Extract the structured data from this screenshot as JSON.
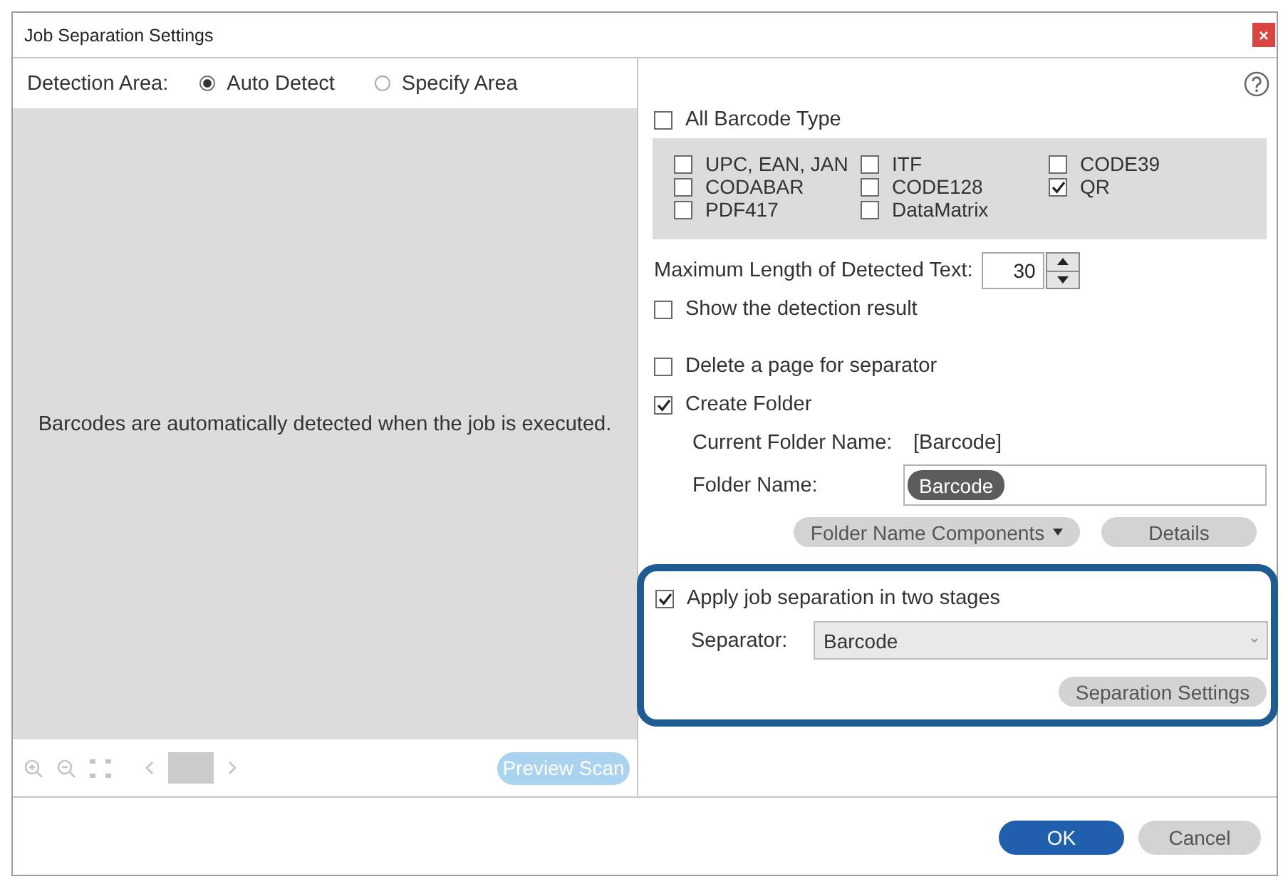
{
  "window": {
    "title": "Job Separation Settings"
  },
  "detection_area": {
    "label": "Detection Area:",
    "options": [
      {
        "label": "Auto Detect",
        "selected": true
      },
      {
        "label": "Specify Area",
        "selected": false
      }
    ]
  },
  "preview": {
    "message": "Barcodes are automatically detected when the job is executed.",
    "disabled": true,
    "preview_button": "Preview Scan"
  },
  "barcode": {
    "all_types": {
      "label": "All Barcode Type",
      "checked": false
    },
    "types": [
      {
        "label": "UPC, EAN, JAN",
        "checked": false
      },
      {
        "label": "ITF",
        "checked": false
      },
      {
        "label": "CODE39",
        "checked": false
      },
      {
        "label": "CODABAR",
        "checked": false
      },
      {
        "label": "CODE128",
        "checked": false
      },
      {
        "label": "QR",
        "checked": true
      },
      {
        "label": "PDF417",
        "checked": false
      },
      {
        "label": "DataMatrix",
        "checked": false
      }
    ]
  },
  "max_length": {
    "label": "Maximum Length of Detected Text:",
    "value": "30"
  },
  "show_result": {
    "label": "Show the detection result",
    "checked": false
  },
  "delete_page": {
    "label": "Delete a page for separator",
    "checked": false
  },
  "create_folder": {
    "label": "Create Folder",
    "checked": true,
    "current_label": "Current Folder Name:",
    "current_value": "[Barcode]",
    "name_label": "Folder Name:",
    "name_tokens": [
      "Barcode"
    ],
    "components_button": "Folder Name Components",
    "details_button": "Details"
  },
  "two_stage": {
    "label": "Apply job separation in two stages",
    "checked": true,
    "highlighted": true,
    "separator_label": "Separator:",
    "separator_value": "Barcode",
    "settings_button": "Separation Settings"
  },
  "buttons": [
    {
      "label": "OK",
      "kind": "primary"
    },
    {
      "label": "Cancel",
      "kind": "secondary"
    }
  ]
}
